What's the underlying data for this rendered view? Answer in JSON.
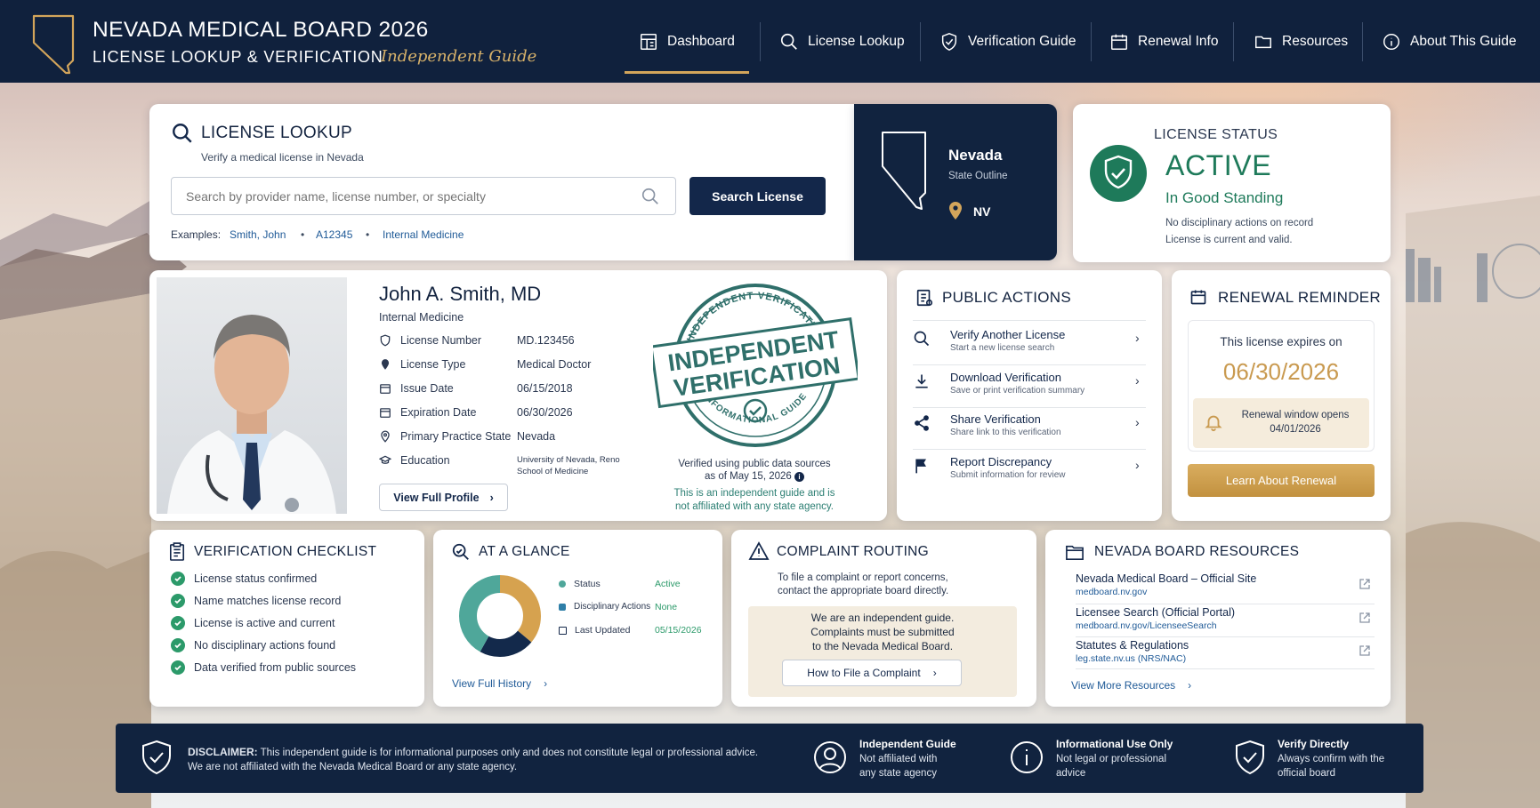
{
  "header": {
    "title": "NEVADA MEDICAL BOARD 2026",
    "subtitle": "LICENSE LOOKUP & VERIFICATION",
    "tagline": "Independent Guide",
    "nav": [
      {
        "label": "Dashboard",
        "icon": "dashboard-icon",
        "active": true
      },
      {
        "label": "License Lookup",
        "icon": "search-icon"
      },
      {
        "label": "Verification Guide",
        "icon": "shield-check-icon"
      },
      {
        "label": "Renewal Info",
        "icon": "calendar-icon"
      },
      {
        "label": "Resources",
        "icon": "folder-icon"
      },
      {
        "label": "About This Guide",
        "icon": "info-icon"
      }
    ]
  },
  "lookup": {
    "title": "LICENSE LOOKUP",
    "subtitle": "Verify a medical license in Nevada",
    "placeholder": "Search by provider name, license number, or specialty",
    "button": "Search License",
    "examples_label": "Examples:",
    "examples": [
      "Smith, John",
      "A12345",
      "Internal Medicine"
    ]
  },
  "state_card": {
    "name": "Nevada",
    "caption": "State Outline",
    "code": "NV"
  },
  "status": {
    "label": "LICENSE STATUS",
    "value": "ACTIVE",
    "standing": "In Good Standing",
    "line1": "No disciplinary actions on record",
    "line2": "License is current and valid."
  },
  "provider": {
    "name": "John A. Smith, MD",
    "specialty": "Internal Medicine",
    "fields": [
      {
        "label": "License Number",
        "value": "MD.123456",
        "icon": "shield-icon"
      },
      {
        "label": "License Type",
        "value": "Medical Doctor",
        "icon": "badge-icon"
      },
      {
        "label": "Issue Date",
        "value": "06/15/2018",
        "icon": "calendar-icon"
      },
      {
        "label": "Expiration Date",
        "value": "06/30/2026",
        "icon": "calendar-icon"
      },
      {
        "label": "Primary Practice State",
        "value": "Nevada",
        "icon": "location-icon"
      },
      {
        "label": "Education",
        "value": "University of Nevada, Reno",
        "value2": "School of Medicine",
        "icon": "graduation-icon"
      }
    ],
    "button": "View Full Profile"
  },
  "stamp": {
    "ring_top": "INDEPENDENT VERIFICATION",
    "line1": "INDEPENDENT",
    "line2": "VERIFICATION",
    "ring_bottom": "INFORMATIONAL GUIDE",
    "verified_line1": "Verified using public data sources",
    "verified_line2": "as of May 15, 2026",
    "note1": "This is an independent guide and is",
    "note2": "not affiliated with any state agency."
  },
  "public_actions": {
    "title": "PUBLIC ACTIONS",
    "items": [
      {
        "title": "Verify Another License",
        "sub": "Start a new license search",
        "icon": "search-icon"
      },
      {
        "title": "Download Verification",
        "sub": "Save or print verification summary",
        "icon": "download-icon"
      },
      {
        "title": "Share Verification",
        "sub": "Share link to this verification",
        "icon": "share-icon"
      },
      {
        "title": "Report Discrepancy",
        "sub": "Submit information for review",
        "icon": "flag-icon"
      }
    ]
  },
  "renewal": {
    "title": "RENEWAL REMINDER",
    "expires_label": "This license expires on",
    "date": "06/30/2026",
    "window_line1": "Renewal window opens",
    "window_line2": "04/01/2026",
    "button": "Learn About Renewal"
  },
  "checklist": {
    "title": "VERIFICATION CHECKLIST",
    "items": [
      "License status confirmed",
      "Name matches license record",
      "License is active and current",
      "No disciplinary actions found",
      "Data verified from public sources"
    ]
  },
  "glance": {
    "title": "AT A GLANCE",
    "rows": [
      {
        "label": "Status",
        "value": "Active"
      },
      {
        "label": "Disciplinary Actions",
        "value": "None"
      },
      {
        "label": "Last Updated",
        "value": "05/15/2026"
      }
    ],
    "link": "View Full History",
    "donut": [
      {
        "share": 0.36,
        "color": "#d6a24f"
      },
      {
        "share": 0.22,
        "color": "#13294b"
      },
      {
        "share": 0.42,
        "color": "#4fa79a"
      }
    ]
  },
  "complaint": {
    "title": "COMPLAINT ROUTING",
    "line1": "To file a complaint or report concerns,",
    "line2": "contact the appropriate board directly.",
    "box1": "We are an independent guide.",
    "box2": "Complaints must be submitted",
    "box3": "to the Nevada Medical Board.",
    "button": "How to File a Complaint"
  },
  "resources": {
    "title": "NEVADA BOARD RESOURCES",
    "items": [
      {
        "title": "Nevada Medical Board – Official Site",
        "url": "medboard.nv.gov"
      },
      {
        "title": "Licensee Search (Official Portal)",
        "url": "medboard.nv.gov/LicenseeSearch"
      },
      {
        "title": "Statutes & Regulations",
        "url": "leg.state.nv.us (NRS/NAC)"
      }
    ],
    "link": "View More Resources"
  },
  "footer": {
    "disclaimer_label": "DISCLAIMER:",
    "disclaimer1": " This independent guide is for informational purposes only and does not constitute legal or professional advice.",
    "disclaimer2": "We are not affiliated with the Nevada Medical Board or any state agency.",
    "badges": [
      {
        "title": "Independent Guide",
        "l1": "Not affiliated with",
        "l2": "any state agency",
        "icon": "user-icon"
      },
      {
        "title": "Informational Use Only",
        "l1": "Not legal or professional",
        "l2": "advice",
        "icon": "info-icon"
      },
      {
        "title": "Verify Directly",
        "l1": "Always confirm with the",
        "l2": "official board",
        "icon": "shield-check-icon"
      }
    ]
  },
  "colors": {
    "navy": "#11233f",
    "gold": "#c99a50",
    "green": "#1e7a5a"
  }
}
